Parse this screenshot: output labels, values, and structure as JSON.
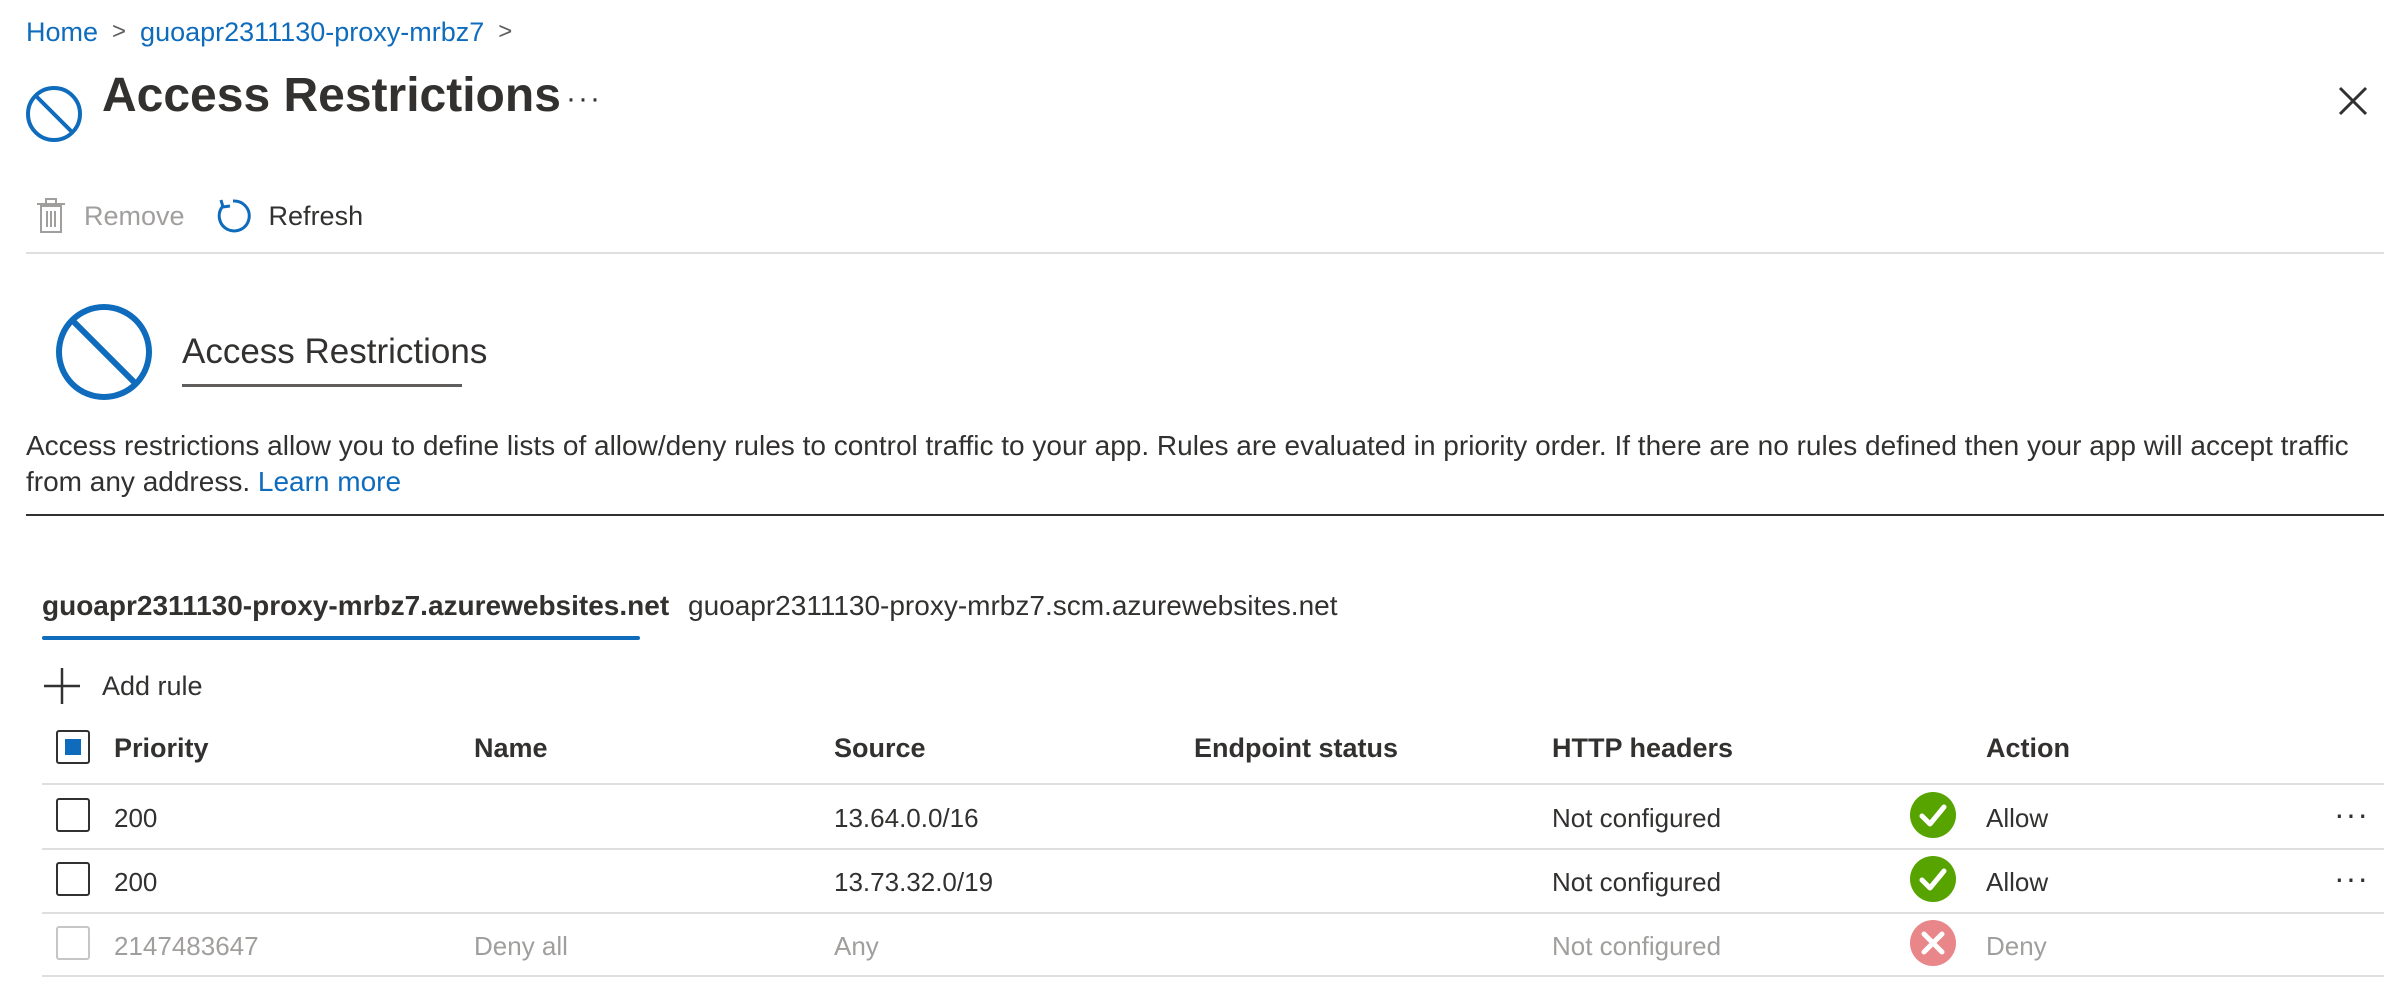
{
  "breadcrumb": {
    "home": "Home",
    "resource": "guoapr2311130-proxy-mrbz7",
    "separator": ">"
  },
  "header": {
    "title": "Access Restrictions",
    "more": "···",
    "icon": "access-restriction-icon",
    "close_icon": "close-icon"
  },
  "toolbar": {
    "remove_label": "Remove",
    "refresh_label": "Refresh"
  },
  "section": {
    "title": "Access Restrictions"
  },
  "description": {
    "text": "Access restrictions allow you to define lists of allow/deny rules to control traffic to your app. Rules are evaluated in priority order. If there are no rules defined then your app will accept traffic from any address.",
    "link": "Learn more"
  },
  "tabs": [
    {
      "label": "guoapr2311130-proxy-mrbz7.azurewebsites.net",
      "selected": true
    },
    {
      "label": "guoapr2311130-proxy-mrbz7.scm.azurewebsites.net",
      "selected": false
    }
  ],
  "add_rule_label": "Add rule",
  "table": {
    "columns": [
      "Priority",
      "Name",
      "Source",
      "Endpoint status",
      "HTTP headers",
      "Action"
    ],
    "rows": [
      {
        "priority": "200",
        "name": "",
        "source": "13.64.0.0/16",
        "endpoint_status": "",
        "http_headers": "Not configured",
        "action": "Allow",
        "status_icon": "check-circle-icon",
        "disabled": false
      },
      {
        "priority": "200",
        "name": "",
        "source": "13.73.32.0/19",
        "endpoint_status": "",
        "http_headers": "Not configured",
        "action": "Allow",
        "status_icon": "check-circle-icon",
        "disabled": false
      },
      {
        "priority": "2147483647",
        "name": "Deny all",
        "source": "Any",
        "endpoint_status": "",
        "http_headers": "Not configured",
        "action": "Deny",
        "status_icon": "x-circle-icon",
        "disabled": true
      }
    ],
    "row_more": "···"
  },
  "colors": {
    "accent": "#0f6cbd",
    "allow_green": "#57a300",
    "deny_red": "#e8868a"
  }
}
